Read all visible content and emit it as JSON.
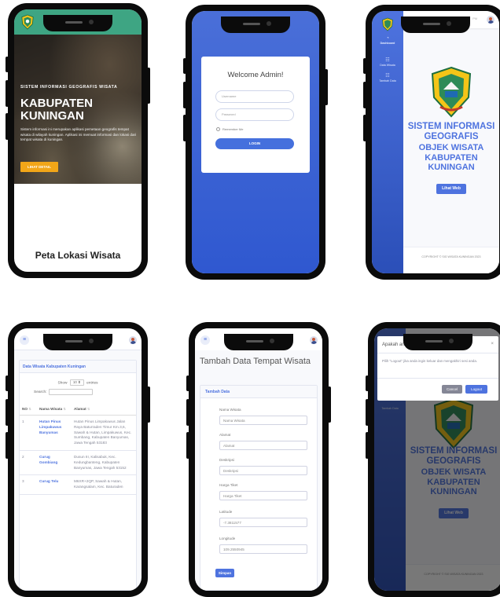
{
  "landing": {
    "subtitle": "SISTEM INFORMASI GEOGRAFIS WISATA",
    "title": "KABUPATEN KUNINGAN",
    "description": "Sistem informasi ini merupakan aplikasi pemetaan geografis tempat wisata di wilayah kuningan. Aplikasi ini memuat informasi dan lokasi dari tempat wisata di kuningan.",
    "cta_label": "LIHAT DETAIL",
    "section_title": "Peta Lokasi Wisata"
  },
  "login": {
    "welcome": "Welcome Admin!",
    "username_placeholder": "Username",
    "password_placeholder": "Password",
    "remember_label": "Remember Me",
    "login_label": "LOGIN"
  },
  "dashboard": {
    "sidebar": {
      "dashboard": "Dashboard",
      "data_wisata": "Data Wisata",
      "tambah_data": "Tambah Data"
    },
    "topbar_date": "Agustus 2023",
    "topbar_time": "PM",
    "title_line1": "SISTEM INFORMASI",
    "title_line2": "GEOGRAFIS",
    "title_line3": "OBJEK WISATA KABUPATEN KUNINGAN",
    "view_button": "Lihat Web",
    "footer": "COPYRIGHT © SIG WISATA KUNINGAN 2023"
  },
  "table_screen": {
    "card_title": "Data Wisata Kabupaten Kuningan",
    "show_label": "Show",
    "entries_value": "10",
    "entries_label": "entries",
    "search_label": "Search:",
    "columns": [
      "NO",
      "Nama Wisata",
      "Alamat"
    ],
    "rows": [
      {
        "no": "1",
        "name": "Hutan Pinus Limpakuwus Banyumas",
        "address": "Hutan Pinus Limpakuwus Jalan Raya Baturraden Timur Km.3,6, Sawah & Hutan, Limpakuwus, Kec. Sumbang, Kabupaten Banyumas, Jawa Tengah 53183"
      },
      {
        "no": "2",
        "name": "Curug Gombiang",
        "address": "Dusun III, Kalisabuk, Kec. Kedungbanteng, Kabupaten Banyumas, Jawa Tengah 53152"
      },
      {
        "no": "3",
        "name": "Curug Telu",
        "address": "M6XR+2QP, Sawah & Hutan, Karangsalam, Kec. Baturaden"
      }
    ]
  },
  "form_screen": {
    "page_title": "Tambah Data Tempat Wisata",
    "card_title": "Tambah Data",
    "fields": [
      {
        "label": "Nama Wisata",
        "value": "Nama Wisata"
      },
      {
        "label": "Alamat",
        "value": "Alamat"
      },
      {
        "label": "Deskripsi",
        "value": "Deskripsi"
      },
      {
        "label": "Harga Tiket",
        "value": "Harga Tiket"
      },
      {
        "label": "Latitude",
        "value": "-7.3811577"
      },
      {
        "label": "Longitude",
        "value": "109.2550945"
      }
    ],
    "save_label": "Simpan"
  },
  "logout_modal": {
    "title": "Apakah anda yakin ingin keluar ?",
    "close": "×",
    "body": "Pilih \"Logout\" jika anda ingin keluar dan mengakhiri sesi anda.",
    "cancel_label": "Cancel",
    "logout_label": "Logout"
  },
  "colors": {
    "primary": "#4e73df",
    "landing_header": "#3ea583",
    "cta": "#f2a618",
    "cancel": "#858796"
  },
  "icons": [
    "kuningan-emblem-icon",
    "hamburger-menu-icon",
    "user-avatar-icon",
    "dashboard-icon",
    "list-icon",
    "plus-icon",
    "close-icon",
    "sort-icon"
  ]
}
